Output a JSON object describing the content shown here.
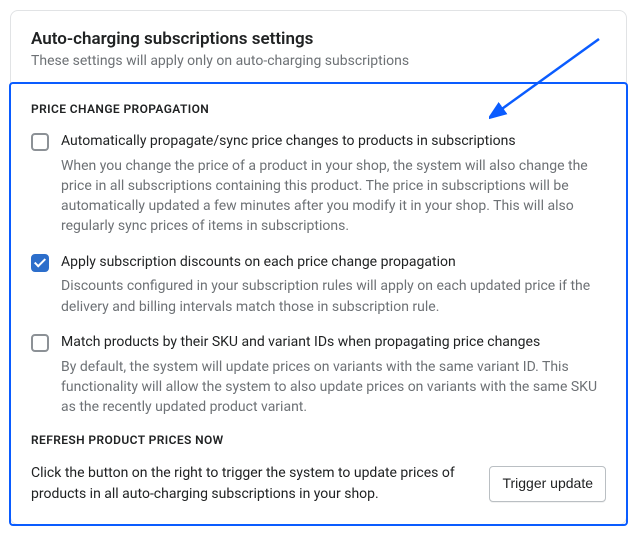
{
  "header": {
    "title": "Auto-charging subscriptions settings",
    "subtitle": "These settings will apply only on auto-charging subscriptions"
  },
  "priceChange": {
    "section_label": "PRICE CHANGE PROPAGATION",
    "opt1": {
      "label": "Automatically propagate/sync price changes to products in subscriptions",
      "desc": "When you change the price of a product in your shop, the system will also change the price in all subscriptions containing this product. The price in subscriptions will be automatically updated a few minutes after you modify it in your shop. This will also regularly sync prices of items in subscriptions."
    },
    "opt2": {
      "label": "Apply subscription discounts on each price change propagation",
      "desc": "Discounts configured in your subscription rules will apply on each updated price if the delivery and billing intervals match those in subscription rule."
    },
    "opt3": {
      "label": "Match products by their SKU and variant IDs when propagating price changes",
      "desc": "By default, the system will update prices on variants with the same variant ID. This functionality will allow the system to also update prices on variants with the same SKU as the recently updated product variant."
    },
    "refresh": {
      "section_label": "REFRESH PRODUCT PRICES NOW",
      "desc": "Click the button on the right to trigger the system to update prices of products in all auto-charging subscriptions in your shop.",
      "button": "Trigger update"
    }
  }
}
